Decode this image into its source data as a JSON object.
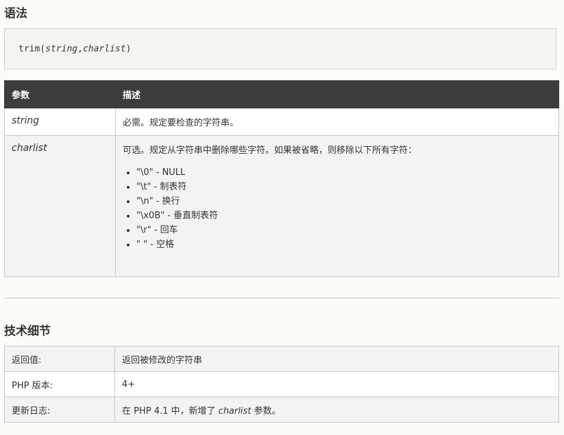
{
  "syntax": {
    "heading": "语法",
    "code_fn": "trim(",
    "code_arg1": "string",
    "code_comma": ",",
    "code_arg2": "charlist",
    "code_close": ")"
  },
  "params_table": {
    "headers": [
      "参数",
      "描述"
    ],
    "rows": [
      {
        "param": "string",
        "desc": "必需。规定要检查的字符串。"
      },
      {
        "param": "charlist",
        "desc": "可选。规定从字符串中删除哪些字符。如果被省略，则移除以下所有字符：",
        "items": [
          "\"\\0\" - NULL",
          "\"\\t\" - 制表符",
          "\"\\n\" - 换行",
          "\"\\x0B\" - 垂直制表符",
          "\"\\r\" - 回车",
          "\" \" - 空格"
        ]
      }
    ]
  },
  "tech": {
    "heading": "技术细节",
    "rows": [
      {
        "label": "返回值:",
        "value": "返回被修改的字符串"
      },
      {
        "label": "PHP 版本:",
        "value": "4+"
      },
      {
        "label": "更新日志:",
        "value_pre": "在 PHP 4.1 中，新增了 ",
        "value_em": "charlist",
        "value_post": " 参数。"
      }
    ]
  }
}
